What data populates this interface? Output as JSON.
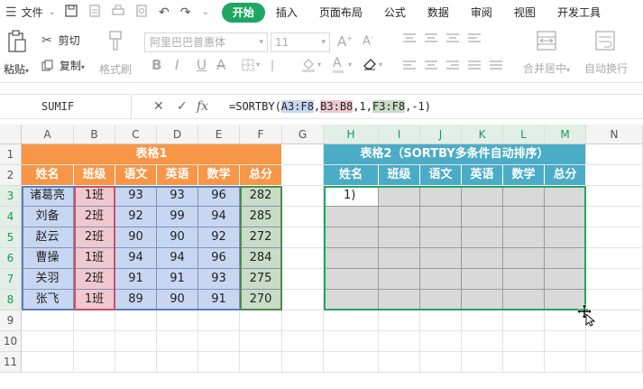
{
  "menubar": {
    "file_label": "文件",
    "tabs": [
      "开始",
      "插入",
      "页面布局",
      "公式",
      "数据",
      "审阅",
      "视图",
      "开发工具"
    ]
  },
  "ribbon": {
    "paste": "粘贴",
    "cut": "剪切",
    "copy": "复制",
    "format_painter": "格式刷",
    "font_name": "阿里巴巴普惠体",
    "font_size": "11",
    "merge_center": "合并居中",
    "wrap_text": "自动换行"
  },
  "formula_bar": {
    "name_box": "SUMIF",
    "fx": "fx",
    "formula_prefix": "=SORTBY(",
    "ref1": "A3:F8",
    "ref2": "B3:B8",
    "mid": ",1,",
    "ref3": "F3:F8",
    "suffix": ",-1)"
  },
  "columns": [
    "A",
    "B",
    "C",
    "D",
    "E",
    "F",
    "G",
    "H",
    "I",
    "J",
    "K",
    "L",
    "M",
    "N"
  ],
  "rows": [
    "1",
    "2",
    "3",
    "4",
    "5",
    "6",
    "7",
    "8",
    "9",
    "10",
    "11"
  ],
  "table1": {
    "title": "表格1",
    "headers": [
      "姓名",
      "班级",
      "语文",
      "英语",
      "数学",
      "总分"
    ],
    "data": [
      [
        "诸葛亮",
        "1班",
        "93",
        "93",
        "96",
        "282"
      ],
      [
        "刘备",
        "2班",
        "92",
        "99",
        "94",
        "285"
      ],
      [
        "赵云",
        "2班",
        "90",
        "90",
        "92",
        "272"
      ],
      [
        "曹操",
        "1班",
        "94",
        "94",
        "96",
        "284"
      ],
      [
        "关羽",
        "2班",
        "91",
        "91",
        "93",
        "275"
      ],
      [
        "张飞",
        "1班",
        "89",
        "90",
        "91",
        "270"
      ]
    ]
  },
  "table2": {
    "title": "表格2（SORTBY多条件自动排序）",
    "headers": [
      "姓名",
      "班级",
      "语文",
      "英语",
      "数学",
      "总分"
    ],
    "active_cell_text": "1)"
  },
  "colors": {
    "accent_green": "#1fa761",
    "table1_header": "#f79646",
    "table2_header": "#4aacc6",
    "ref_blue": "#c7d7f2",
    "ref_pink": "#f0c8cf",
    "ref_green": "#c8dcc6"
  }
}
